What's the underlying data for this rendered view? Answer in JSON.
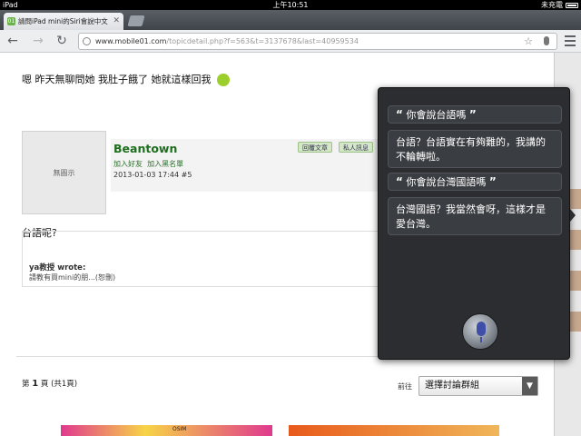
{
  "statusbar": {
    "device": "iPad",
    "time": "上午10:51",
    "battery_text": "未充電"
  },
  "browser": {
    "tab_title": "請問iPad mini的Siri會說中文",
    "url_host": "www.mobile01.com",
    "url_path": "/topicdetail.php?f=563&t=3137678&last=40959534"
  },
  "post": {
    "top_message": "嗯 昨天無聊問她 我肚子餓了 她就這樣回我",
    "avatar_text": "無圖示",
    "username": "Beantown",
    "add_friend": "加入好友",
    "add_blacklist": "加入黑名單",
    "timestamp": "2013-01-03 17:44",
    "post_number": "#5",
    "reply_button": "回覆文章",
    "pm_button": "私人訊息",
    "reply_text": "台語呢?",
    "quote_author": "ya教授 wrote:",
    "quote_body": "請教有買mini的朋...(恕刪)"
  },
  "pager": {
    "page": "1",
    "suffix": " 頁 (共1頁)",
    "prefix": "第 ",
    "goto_label": "前往",
    "select_value": "選擇討論群組"
  },
  "siri": {
    "q1": "你會說台語嗎",
    "a1": "台語？台語實在有夠難的，我講的不輪轉啦。",
    "q2": "你會說台灣國語嗎",
    "a2": "台灣國語？我當然會呀，這樣才是愛台灣。"
  },
  "ads": {
    "label": "OSIM"
  }
}
